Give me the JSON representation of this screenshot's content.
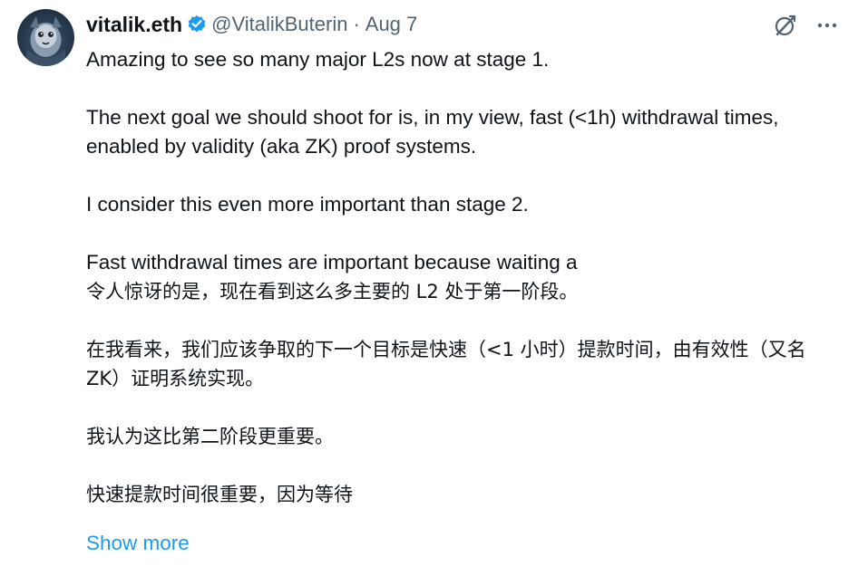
{
  "author": {
    "display_name": "vitalik.eth",
    "handle": "@VitalikButerin",
    "separator": "·",
    "date": "Aug 7",
    "verified_icon": "verified-badge-icon",
    "avatar_icon": "avatar"
  },
  "actions": {
    "grok_icon": "grok-icon",
    "more_icon": "more-icon"
  },
  "tweet": {
    "en_1": "Amazing to see so many major L2s now at stage 1.",
    "en_2": "The next goal we should shoot for is, in my view, fast (<1h) withdrawal times, enabled by validity (aka ZK) proof systems.",
    "en_3": "I consider this even more important than stage 2.",
    "en_4": "Fast withdrawal times are important because waiting a",
    "zh_1": "令人惊讶的是，现在看到这么多主要的 L2 处于第一阶段。",
    "zh_2": "在我看来，我们应该争取的下一个目标是快速（<1 小时）提款时间，由有效性（又名 ZK）证明系统实现。",
    "zh_3": "我认为这比第二阶段更重要。",
    "zh_4": "快速提款时间很重要，因为等待",
    "show_more": "Show more"
  },
  "colors": {
    "text": "#0f1419",
    "secondary": "#536471",
    "accent": "#1d9bf0"
  }
}
